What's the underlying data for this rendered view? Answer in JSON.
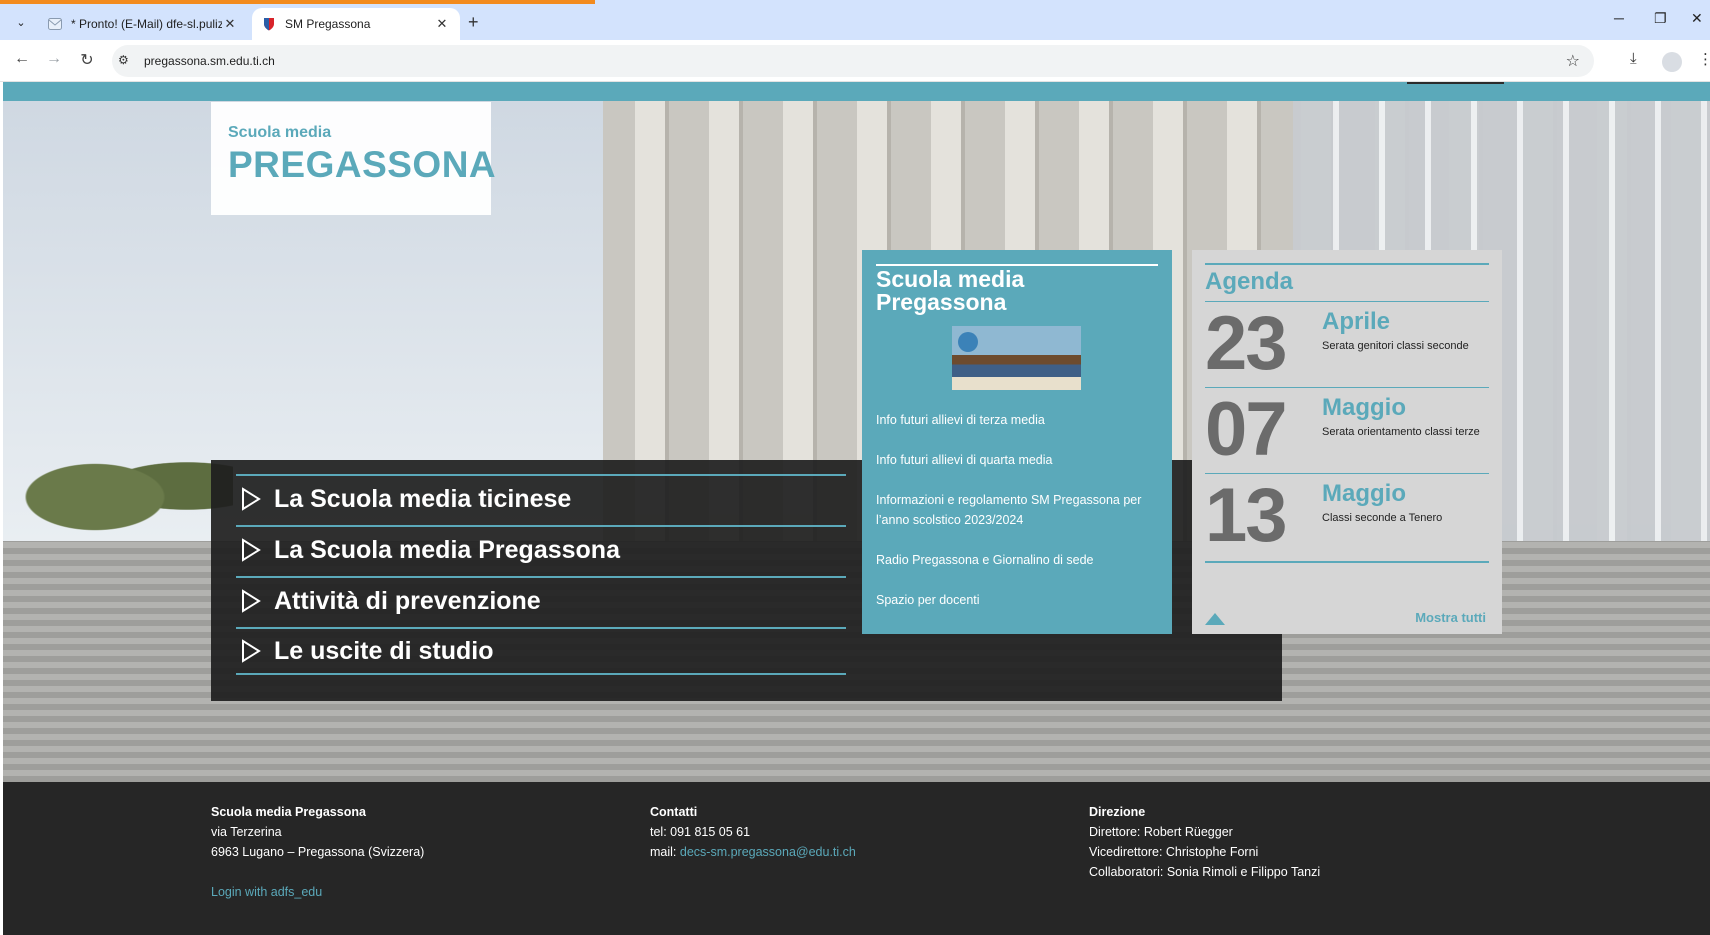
{
  "browser": {
    "tabs": [
      {
        "title": "* Pronto! (E-Mail) dfe-sl.pulizia",
        "active": false
      },
      {
        "title": "SM Pregassona",
        "active": true
      }
    ],
    "url": "pregassona.sm.edu.ti.ch"
  },
  "logo": {
    "small": "Scuola media",
    "big": "PREGASSONA"
  },
  "menu": [
    {
      "label": "La Scuola media ticinese"
    },
    {
      "label": "La Scuola media Pregassona"
    },
    {
      "label": "Attività di prevenzione"
    },
    {
      "label": "Le uscite di studio"
    }
  ],
  "infobox": {
    "heading": "Scuola media Pregassona",
    "links": [
      "Info futuri allievi di terza media",
      "Info futuri allievi di quarta media",
      "Informazioni e regolamento SM Pregassona per l’anno scolstico 2023/2024",
      "Radio Pregassona e Giornalino di sede",
      "Spazio per docenti"
    ]
  },
  "agenda": {
    "title": "Agenda",
    "entries": [
      {
        "day": "23",
        "month": "Aprile",
        "desc": "Serata genitori classi seconde"
      },
      {
        "day": "07",
        "month": "Maggio",
        "desc": "Serata orientamento classi terze"
      },
      {
        "day": "13",
        "month": "Maggio",
        "desc": "Classi seconde a Tenero"
      }
    ],
    "show_all": "Mostra tutti"
  },
  "footer": {
    "school": {
      "heading": "Scuola media Pregassona",
      "street": "via Terzerina",
      "city": "6963 Lugano – Pregassona (Svizzera)",
      "login": "Login with adfs_edu"
    },
    "contacts": {
      "heading": "Contatti",
      "tel": "tel: 091 815 05 61",
      "mail_prefix": "mail: ",
      "mail": "decs-sm.pregassona@edu.ti.ch"
    },
    "direction": {
      "heading": "Direzione",
      "director": "Direttore: Robert Rüegger",
      "vice": "Vicedirettore: Christophe Forni",
      "collab": "Collaboratori: Sonia Rimoli e Filippo Tanzi"
    }
  },
  "colors": {
    "accent": "#5ba9ba",
    "dark": "#262626",
    "agenda_bg": "#d6d6d6"
  }
}
